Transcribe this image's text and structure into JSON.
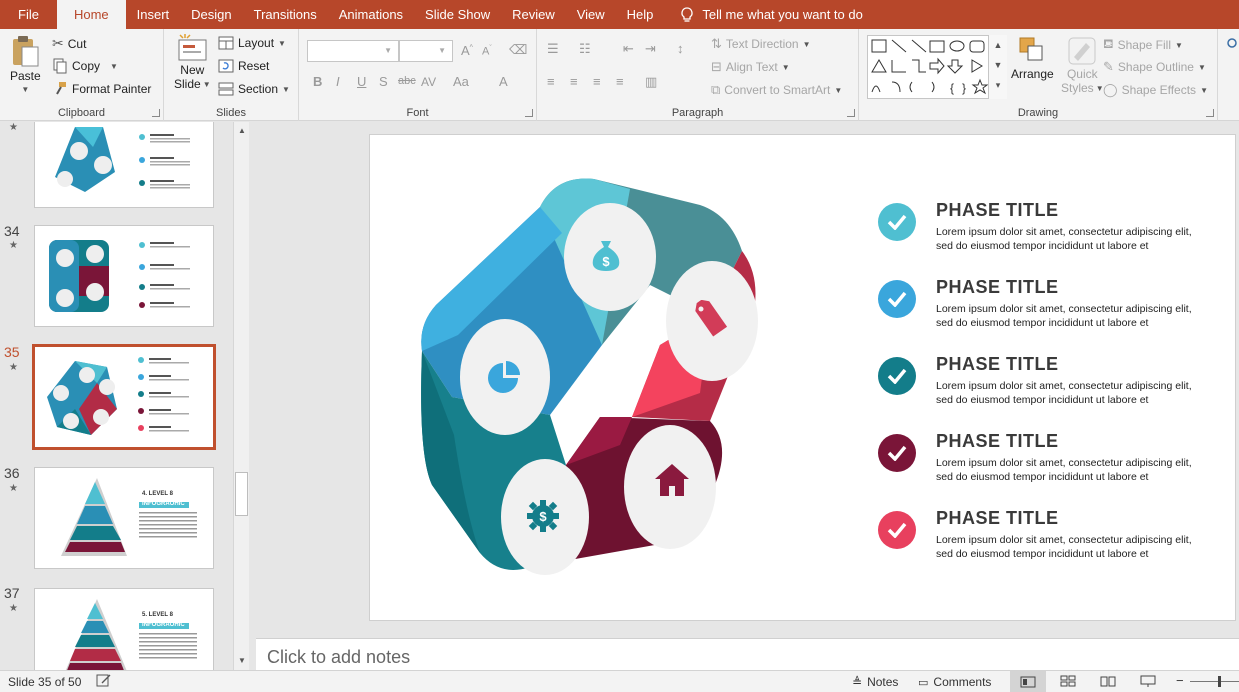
{
  "menu": {
    "tabs": [
      "File",
      "Home",
      "Insert",
      "Design",
      "Transitions",
      "Animations",
      "Slide Show",
      "Review",
      "View",
      "Help"
    ],
    "active": "Home",
    "tell_me": "Tell me what you want to do"
  },
  "ribbon": {
    "clipboard": {
      "paste": "Paste",
      "cut": "Cut",
      "copy": "Copy",
      "format_painter": "Format Painter",
      "label": "Clipboard"
    },
    "slides": {
      "new_slide_1": "New",
      "new_slide_2": "Slide",
      "layout": "Layout",
      "reset": "Reset",
      "section": "Section",
      "label": "Slides"
    },
    "font": {
      "label": "Font",
      "bold": "B",
      "italic": "I",
      "underline": "U",
      "shadow": "S",
      "strike": "abc",
      "spacing": "AV",
      "case": "Aa",
      "color": "A"
    },
    "paragraph": {
      "text_direction": "Text Direction",
      "align_text": "Align Text",
      "smartart": "Convert to SmartArt",
      "label": "Paragraph"
    },
    "drawing": {
      "arrange": "Arrange",
      "quick_styles_1": "Quick",
      "quick_styles_2": "Styles",
      "shape_fill": "Shape Fill",
      "shape_outline": "Shape Outline",
      "shape_effects": "Shape Effects",
      "label": "Drawing"
    }
  },
  "thumbnails": [
    {
      "number": "",
      "star": "★"
    },
    {
      "number": "34",
      "star": "★"
    },
    {
      "number": "35",
      "star": "★"
    },
    {
      "number": "36",
      "star": "★",
      "title1": "4. LEVEL 8",
      "title2": "INFOGRAOHIC"
    },
    {
      "number": "37",
      "star": "★",
      "title1": "5. LEVEL 8",
      "title2": "INFOGRAOHIC"
    }
  ],
  "slide": {
    "phases": [
      {
        "title": "PHASE TITLE",
        "body": "Lorem ipsum dolor sit amet, consectetur adipiscing elit, sed do eiusmod tempor incididunt ut labore et",
        "color": "#4fbfd1"
      },
      {
        "title": "PHASE TITLE",
        "body": "Lorem ipsum dolor sit amet, consectetur adipiscing elit, sed do eiusmod tempor incididunt ut labore et",
        "color": "#3aa6dc"
      },
      {
        "title": "PHASE TITLE",
        "body": "Lorem ipsum dolor sit amet, consectetur adipiscing elit, sed do eiusmod tempor incididunt ut labore et",
        "color": "#137d8a"
      },
      {
        "title": "PHASE TITLE",
        "body": "Lorem ipsum dolor sit amet, consectetur adipiscing elit, sed do eiusmod tempor incididunt ut labore et",
        "color": "#7a1538"
      },
      {
        "title": "PHASE TITLE",
        "body": "Lorem ipsum dolor sit amet, consectetur adipiscing elit, sed do eiusmod tempor incididunt ut labore et",
        "color": "#e8405e"
      }
    ]
  },
  "notes": {
    "placeholder": "Click to add notes"
  },
  "status": {
    "slide": "Slide 35 of 50",
    "notes": "Notes",
    "comments": "Comments"
  },
  "colors": {
    "accent": "#b7472a",
    "teal_light": "#4fbfd1",
    "blue": "#3aa6dc",
    "teal_dark": "#137d8a",
    "maroon": "#7a1538",
    "pink": "#e8405e"
  }
}
